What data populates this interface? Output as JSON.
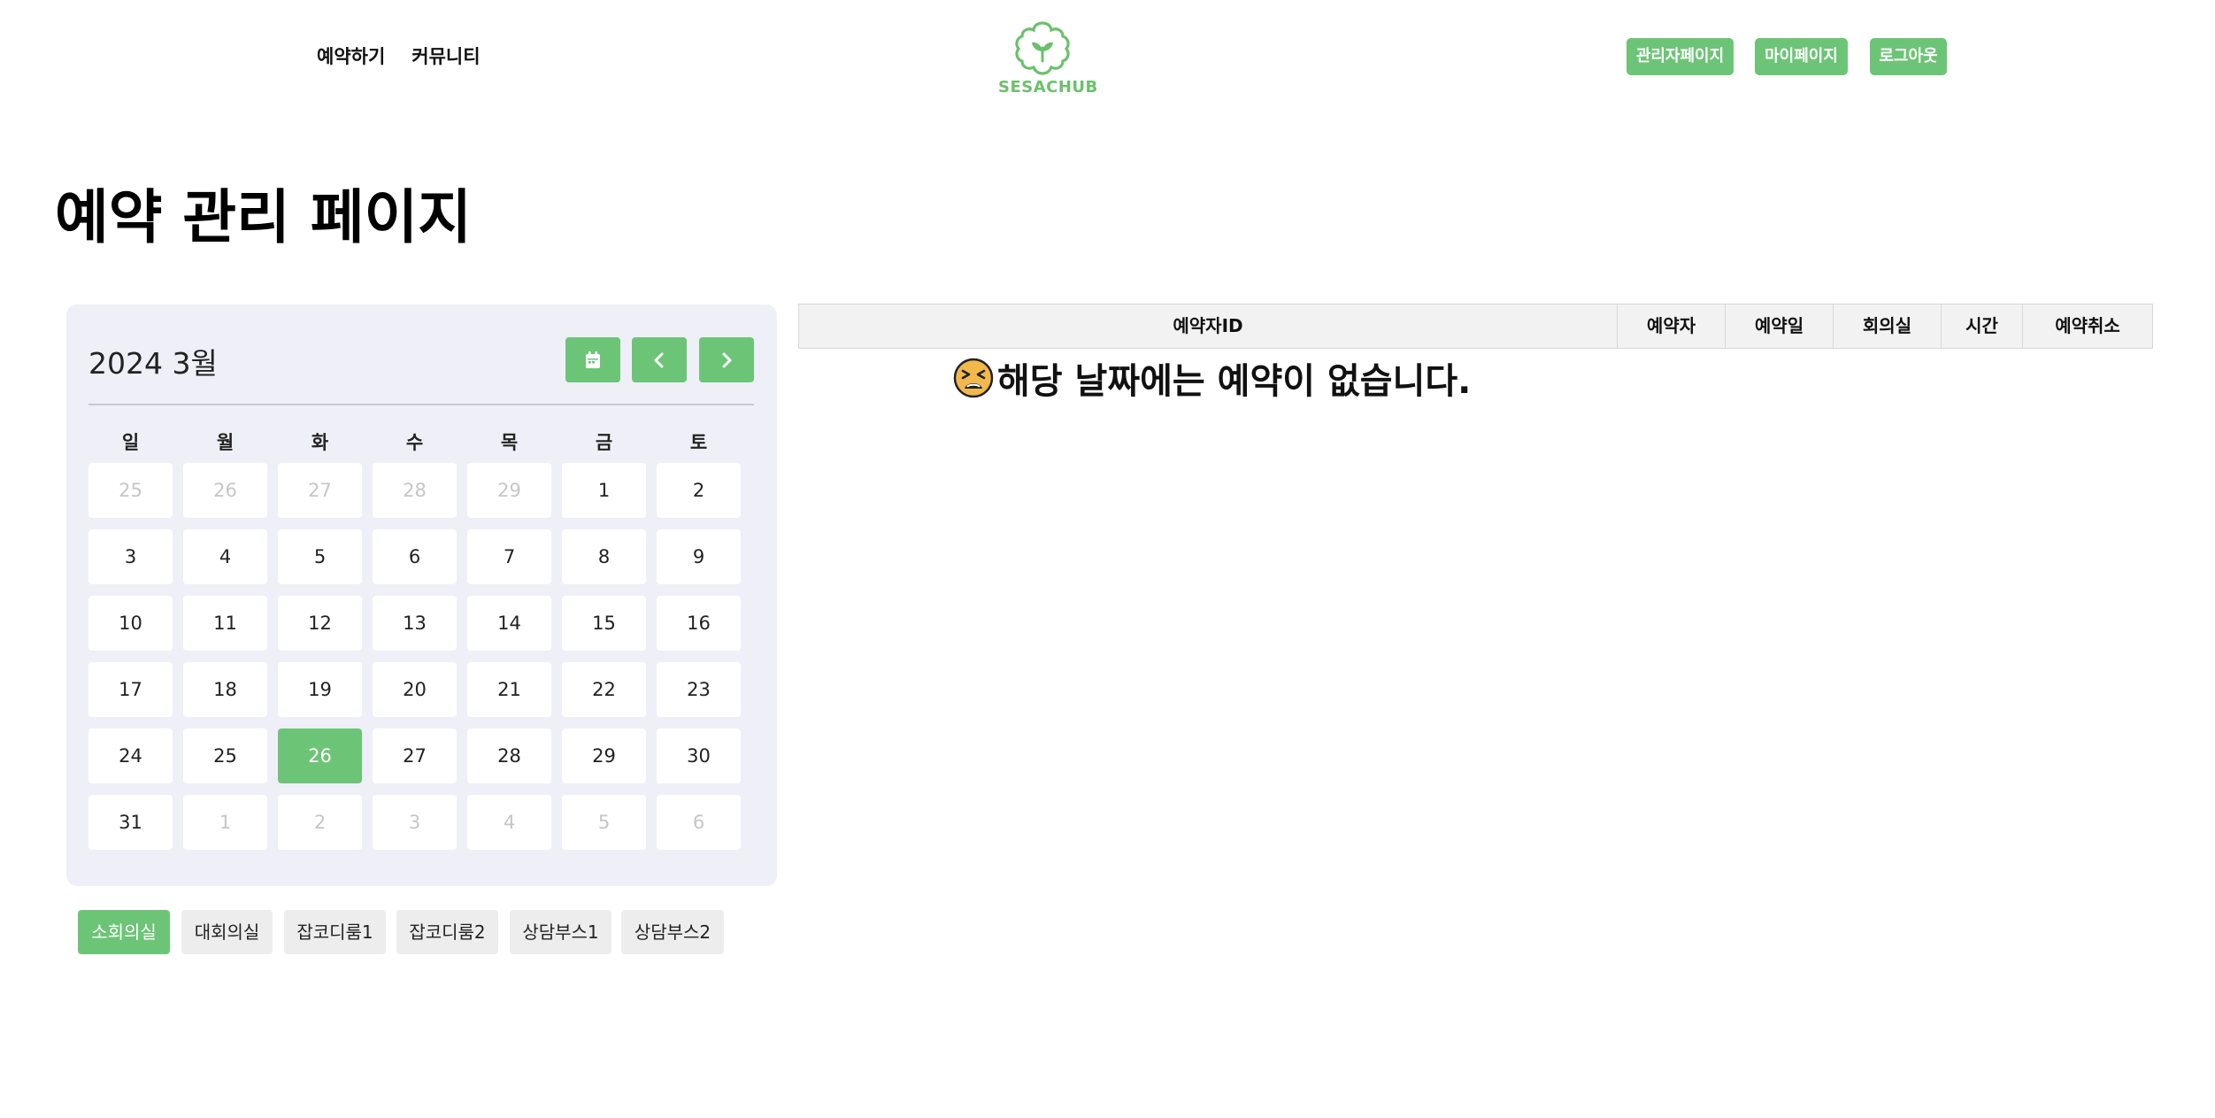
{
  "header": {
    "nav": [
      "예약하기",
      "커뮤니티"
    ],
    "logo_text": "SESACHUB",
    "buttons": [
      "관리자페이지",
      "마이페이지",
      "로그아웃"
    ],
    "accent_color": "#6cc576"
  },
  "page_title": "예약 관리 페이지",
  "calendar": {
    "month_label": "2024 3월",
    "controls": [
      "calendar-icon",
      "chevron-left-icon",
      "chevron-right-icon"
    ],
    "weekdays": [
      "일",
      "월",
      "화",
      "수",
      "목",
      "금",
      "토"
    ],
    "weeks": [
      [
        "25",
        "26",
        "27",
        "28",
        "29",
        "1",
        "2"
      ],
      [
        "3",
        "4",
        "5",
        "6",
        "7",
        "8",
        "9"
      ],
      [
        "10",
        "11",
        "12",
        "13",
        "14",
        "15",
        "16"
      ],
      [
        "17",
        "18",
        "19",
        "20",
        "21",
        "22",
        "23"
      ],
      [
        "24",
        "25",
        "26",
        "27",
        "28",
        "29",
        "30"
      ],
      [
        "31",
        "1",
        "2",
        "3",
        "4",
        "5",
        "6"
      ]
    ],
    "selected": "26"
  },
  "rooms": {
    "items": [
      "소회의실",
      "대회의실",
      "잡코디룸1",
      "잡코디룸2",
      "상담부스1",
      "상담부스2"
    ],
    "active": "소회의실"
  },
  "table": {
    "headers": [
      "예약자ID",
      "예약자",
      "예약일",
      "회의실",
      "시간",
      "예약취소"
    ],
    "empty_message": "해당 날짜에는 예약이 없습니다.",
    "empty_icon": "tired-face-emoji"
  }
}
